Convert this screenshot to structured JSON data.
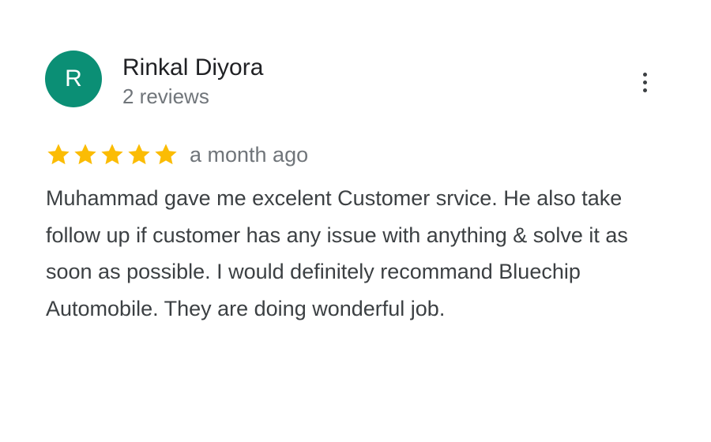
{
  "reviewer": {
    "initial": "R",
    "name": "Rinkal Diyora",
    "review_count": "2 reviews",
    "avatar_color": "#0b8f75"
  },
  "menu": {
    "icon": "more-vert-icon"
  },
  "review": {
    "rating": 5,
    "rating_max": 5,
    "star_color": "#fbbc04",
    "date": "a month ago",
    "text": "Muhammad gave me excelent Customer srvice. He also take follow up if customer has any issue with anything & solve it as soon as possible. I would definitely recommand Bluechip Automobile. They are doing wonderful job."
  }
}
